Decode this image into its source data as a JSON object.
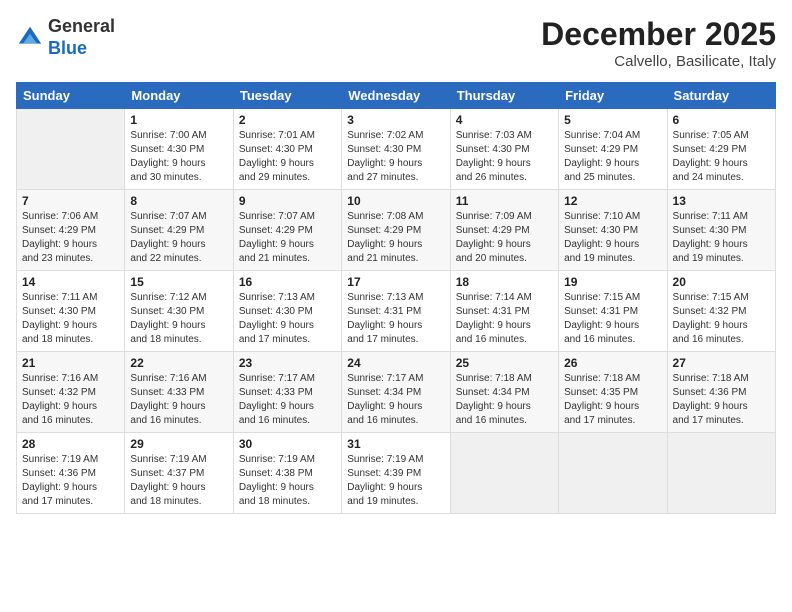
{
  "logo": {
    "general": "General",
    "blue": "Blue"
  },
  "title": "December 2025",
  "location": "Calvello, Basilicate, Italy",
  "weekdays": [
    "Sunday",
    "Monday",
    "Tuesday",
    "Wednesday",
    "Thursday",
    "Friday",
    "Saturday"
  ],
  "weeks": [
    [
      {
        "day": "",
        "info": ""
      },
      {
        "day": "1",
        "info": "Sunrise: 7:00 AM\nSunset: 4:30 PM\nDaylight: 9 hours\nand 30 minutes."
      },
      {
        "day": "2",
        "info": "Sunrise: 7:01 AM\nSunset: 4:30 PM\nDaylight: 9 hours\nand 29 minutes."
      },
      {
        "day": "3",
        "info": "Sunrise: 7:02 AM\nSunset: 4:30 PM\nDaylight: 9 hours\nand 27 minutes."
      },
      {
        "day": "4",
        "info": "Sunrise: 7:03 AM\nSunset: 4:30 PM\nDaylight: 9 hours\nand 26 minutes."
      },
      {
        "day": "5",
        "info": "Sunrise: 7:04 AM\nSunset: 4:29 PM\nDaylight: 9 hours\nand 25 minutes."
      },
      {
        "day": "6",
        "info": "Sunrise: 7:05 AM\nSunset: 4:29 PM\nDaylight: 9 hours\nand 24 minutes."
      }
    ],
    [
      {
        "day": "7",
        "info": "Sunrise: 7:06 AM\nSunset: 4:29 PM\nDaylight: 9 hours\nand 23 minutes."
      },
      {
        "day": "8",
        "info": "Sunrise: 7:07 AM\nSunset: 4:29 PM\nDaylight: 9 hours\nand 22 minutes."
      },
      {
        "day": "9",
        "info": "Sunrise: 7:07 AM\nSunset: 4:29 PM\nDaylight: 9 hours\nand 21 minutes."
      },
      {
        "day": "10",
        "info": "Sunrise: 7:08 AM\nSunset: 4:29 PM\nDaylight: 9 hours\nand 21 minutes."
      },
      {
        "day": "11",
        "info": "Sunrise: 7:09 AM\nSunset: 4:29 PM\nDaylight: 9 hours\nand 20 minutes."
      },
      {
        "day": "12",
        "info": "Sunrise: 7:10 AM\nSunset: 4:30 PM\nDaylight: 9 hours\nand 19 minutes."
      },
      {
        "day": "13",
        "info": "Sunrise: 7:11 AM\nSunset: 4:30 PM\nDaylight: 9 hours\nand 19 minutes."
      }
    ],
    [
      {
        "day": "14",
        "info": "Sunrise: 7:11 AM\nSunset: 4:30 PM\nDaylight: 9 hours\nand 18 minutes."
      },
      {
        "day": "15",
        "info": "Sunrise: 7:12 AM\nSunset: 4:30 PM\nDaylight: 9 hours\nand 18 minutes."
      },
      {
        "day": "16",
        "info": "Sunrise: 7:13 AM\nSunset: 4:30 PM\nDaylight: 9 hours\nand 17 minutes."
      },
      {
        "day": "17",
        "info": "Sunrise: 7:13 AM\nSunset: 4:31 PM\nDaylight: 9 hours\nand 17 minutes."
      },
      {
        "day": "18",
        "info": "Sunrise: 7:14 AM\nSunset: 4:31 PM\nDaylight: 9 hours\nand 16 minutes."
      },
      {
        "day": "19",
        "info": "Sunrise: 7:15 AM\nSunset: 4:31 PM\nDaylight: 9 hours\nand 16 minutes."
      },
      {
        "day": "20",
        "info": "Sunrise: 7:15 AM\nSunset: 4:32 PM\nDaylight: 9 hours\nand 16 minutes."
      }
    ],
    [
      {
        "day": "21",
        "info": "Sunrise: 7:16 AM\nSunset: 4:32 PM\nDaylight: 9 hours\nand 16 minutes."
      },
      {
        "day": "22",
        "info": "Sunrise: 7:16 AM\nSunset: 4:33 PM\nDaylight: 9 hours\nand 16 minutes."
      },
      {
        "day": "23",
        "info": "Sunrise: 7:17 AM\nSunset: 4:33 PM\nDaylight: 9 hours\nand 16 minutes."
      },
      {
        "day": "24",
        "info": "Sunrise: 7:17 AM\nSunset: 4:34 PM\nDaylight: 9 hours\nand 16 minutes."
      },
      {
        "day": "25",
        "info": "Sunrise: 7:18 AM\nSunset: 4:34 PM\nDaylight: 9 hours\nand 16 minutes."
      },
      {
        "day": "26",
        "info": "Sunrise: 7:18 AM\nSunset: 4:35 PM\nDaylight: 9 hours\nand 17 minutes."
      },
      {
        "day": "27",
        "info": "Sunrise: 7:18 AM\nSunset: 4:36 PM\nDaylight: 9 hours\nand 17 minutes."
      }
    ],
    [
      {
        "day": "28",
        "info": "Sunrise: 7:19 AM\nSunset: 4:36 PM\nDaylight: 9 hours\nand 17 minutes."
      },
      {
        "day": "29",
        "info": "Sunrise: 7:19 AM\nSunset: 4:37 PM\nDaylight: 9 hours\nand 18 minutes."
      },
      {
        "day": "30",
        "info": "Sunrise: 7:19 AM\nSunset: 4:38 PM\nDaylight: 9 hours\nand 18 minutes."
      },
      {
        "day": "31",
        "info": "Sunrise: 7:19 AM\nSunset: 4:39 PM\nDaylight: 9 hours\nand 19 minutes."
      },
      {
        "day": "",
        "info": ""
      },
      {
        "day": "",
        "info": ""
      },
      {
        "day": "",
        "info": ""
      }
    ]
  ]
}
